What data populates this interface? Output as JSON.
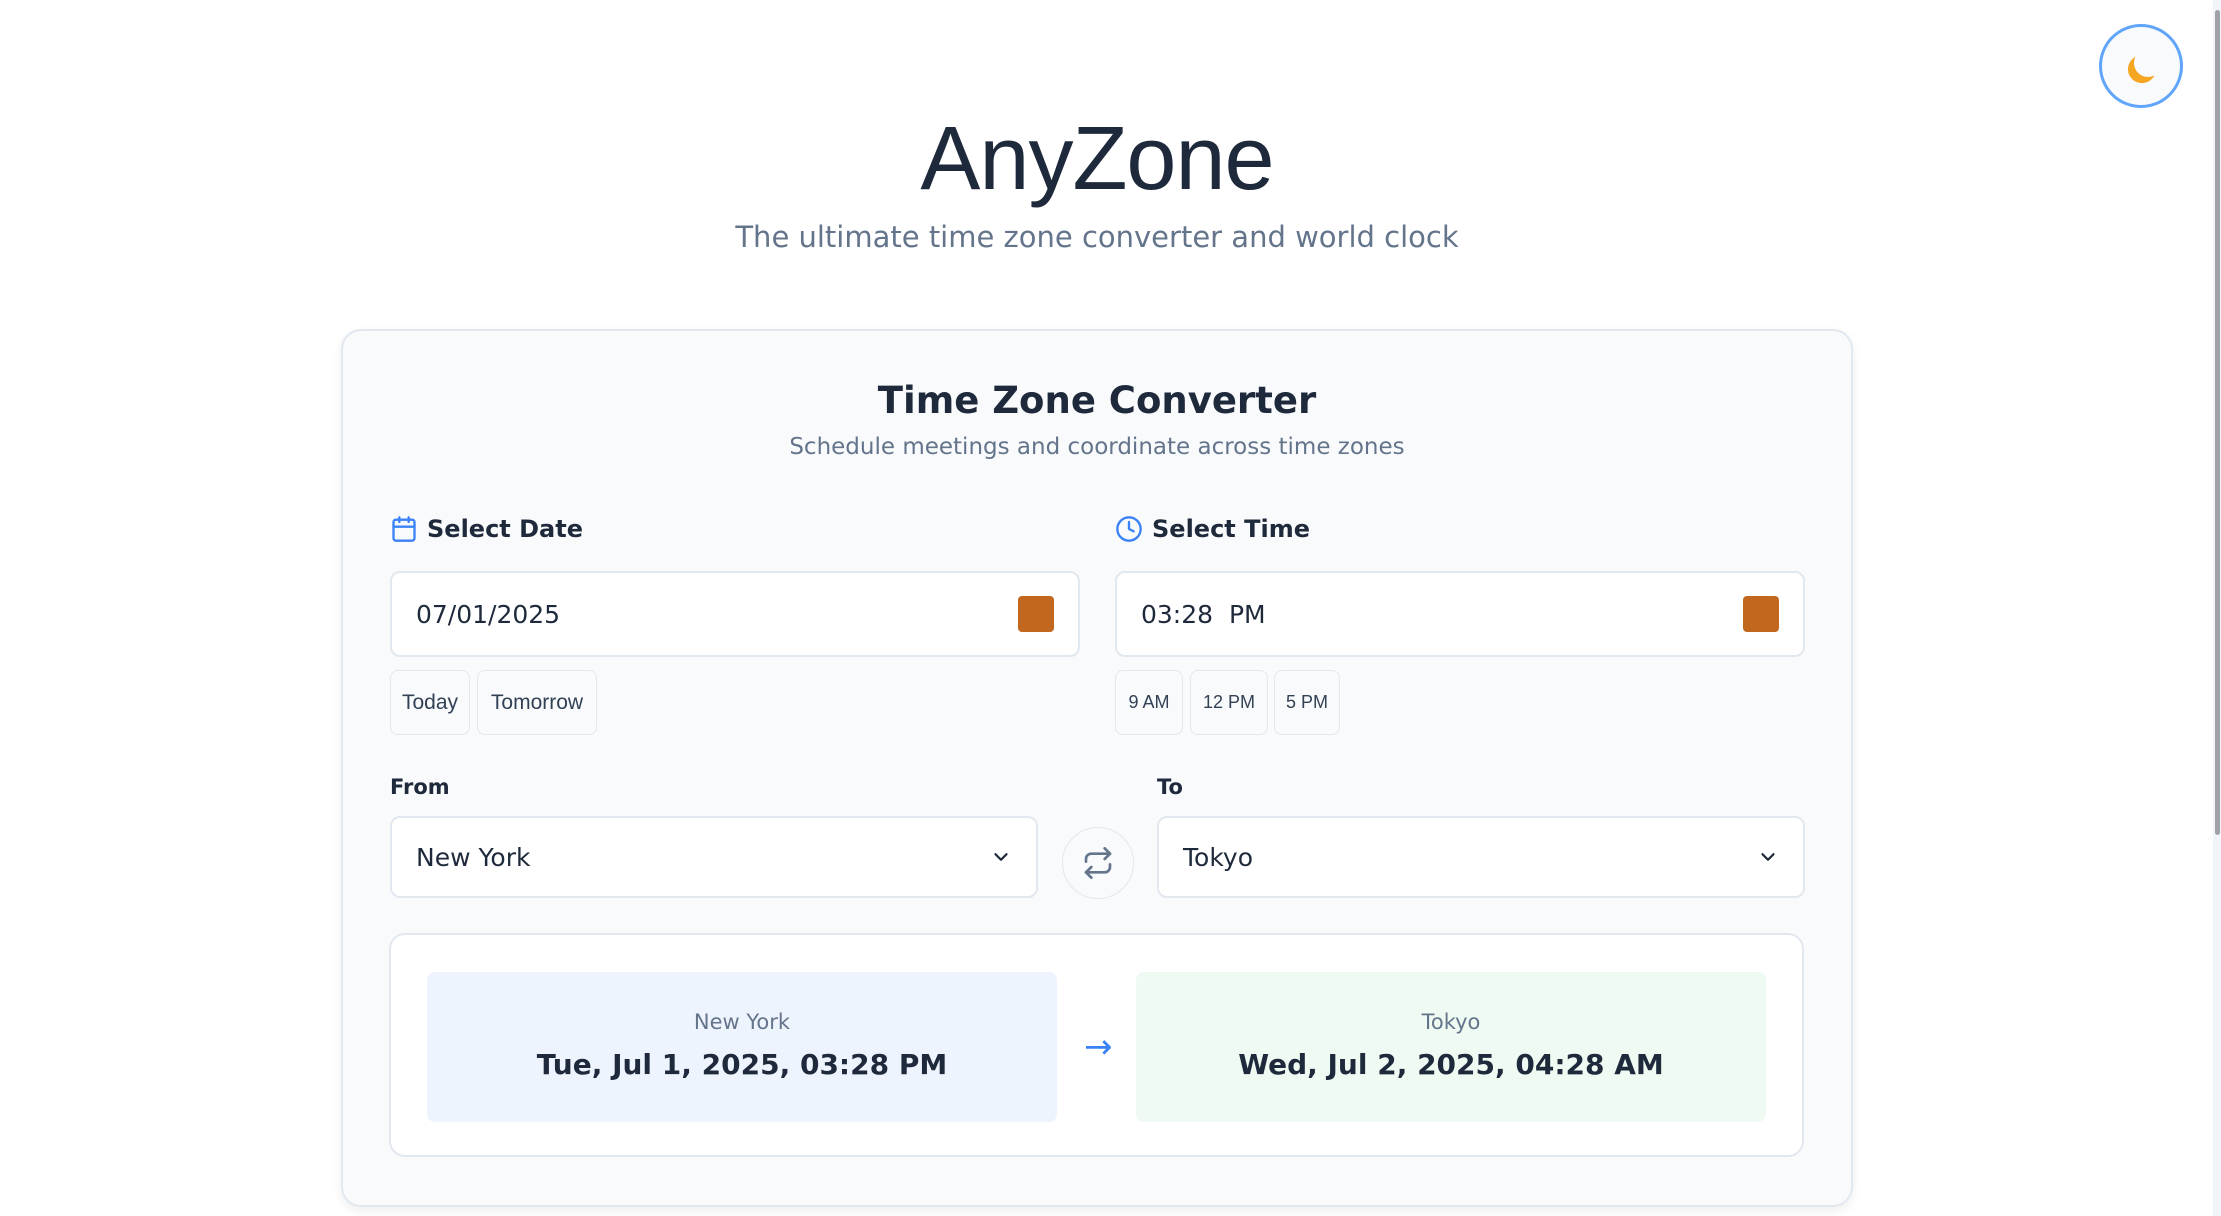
{
  "app": {
    "title": "AnyZone",
    "subtitle": "The ultimate time zone converter and world clock"
  },
  "theme_toggle": {
    "icon": "moon-icon"
  },
  "converter": {
    "title": "Time Zone Converter",
    "subtitle": "Schedule meetings and coordinate across time zones",
    "date": {
      "label": "Select Date",
      "value": "07/01/2025",
      "quick_options": [
        "Today",
        "Tomorrow"
      ]
    },
    "time": {
      "label": "Select Time",
      "value": "03:28  PM",
      "quick_options": [
        "9 AM",
        "12 PM",
        "5 PM"
      ]
    },
    "from": {
      "label": "From",
      "value": "New York"
    },
    "to": {
      "label": "To",
      "value": "Tokyo"
    }
  },
  "result": {
    "from": {
      "city": "New York",
      "datetime": "Tue, Jul 1, 2025, 03:28 PM",
      "bg": "#eef4fd"
    },
    "to": {
      "city": "Tokyo",
      "datetime": "Wed, Jul 2, 2025, 04:28 AM",
      "bg": "#eefaf2"
    },
    "arrow": "→"
  },
  "colors": {
    "accent": "#3b82f6",
    "picker_icon": "#c2681e"
  }
}
